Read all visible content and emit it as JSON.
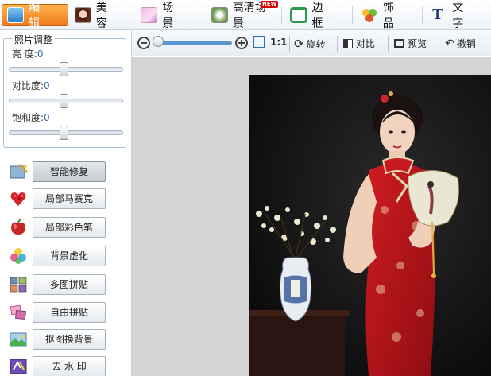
{
  "tabs": [
    {
      "label": "编 辑",
      "icon": "edit-icon",
      "active": true
    },
    {
      "label": "美 容",
      "icon": "beauty-icon",
      "active": false
    },
    {
      "label": "场 景",
      "icon": "scene-icon",
      "active": false
    },
    {
      "label": "高清场景",
      "icon": "hd-scene-icon",
      "active": false,
      "badge": "NEW"
    },
    {
      "label": "边 框",
      "icon": "frame-icon",
      "active": false
    },
    {
      "label": "饰 品",
      "icon": "accessory-icon",
      "active": false
    },
    {
      "label": "文 字",
      "icon": "text-icon",
      "active": false
    }
  ],
  "adjust": {
    "title": "照片调整",
    "brightness": {
      "label": "亮    度:",
      "value": "0"
    },
    "contrast": {
      "label": "对比度:",
      "value": "0"
    },
    "saturation": {
      "label": "饱和度:",
      "value": "0"
    }
  },
  "tools": [
    {
      "label": "智能修复",
      "icon": "smart-repair-icon",
      "active": true
    },
    {
      "label": "局部马赛克",
      "icon": "mosaic-icon",
      "active": false
    },
    {
      "label": "局部彩色笔",
      "icon": "color-pen-icon",
      "active": false
    },
    {
      "label": "背景虚化",
      "icon": "blur-background-icon",
      "active": false
    },
    {
      "label": "多图拼贴",
      "icon": "multi-collage-icon",
      "active": false
    },
    {
      "label": "自由拼贴",
      "icon": "free-collage-icon",
      "active": false
    },
    {
      "label": "抠图换背景",
      "icon": "cutout-icon",
      "active": false
    },
    {
      "label": "去 水 印",
      "icon": "watermark-icon",
      "active": false
    }
  ],
  "toolbar": {
    "actual_size": "1:1",
    "rotate": "旋转",
    "compare": "对比",
    "preview": "预览",
    "undo": "撤销"
  },
  "colors": {
    "active_tab": "#f07a1a",
    "panel_border": "#aac0d8",
    "canvas_bg": "#d4d4d4",
    "dress_red": "#c4161c"
  }
}
